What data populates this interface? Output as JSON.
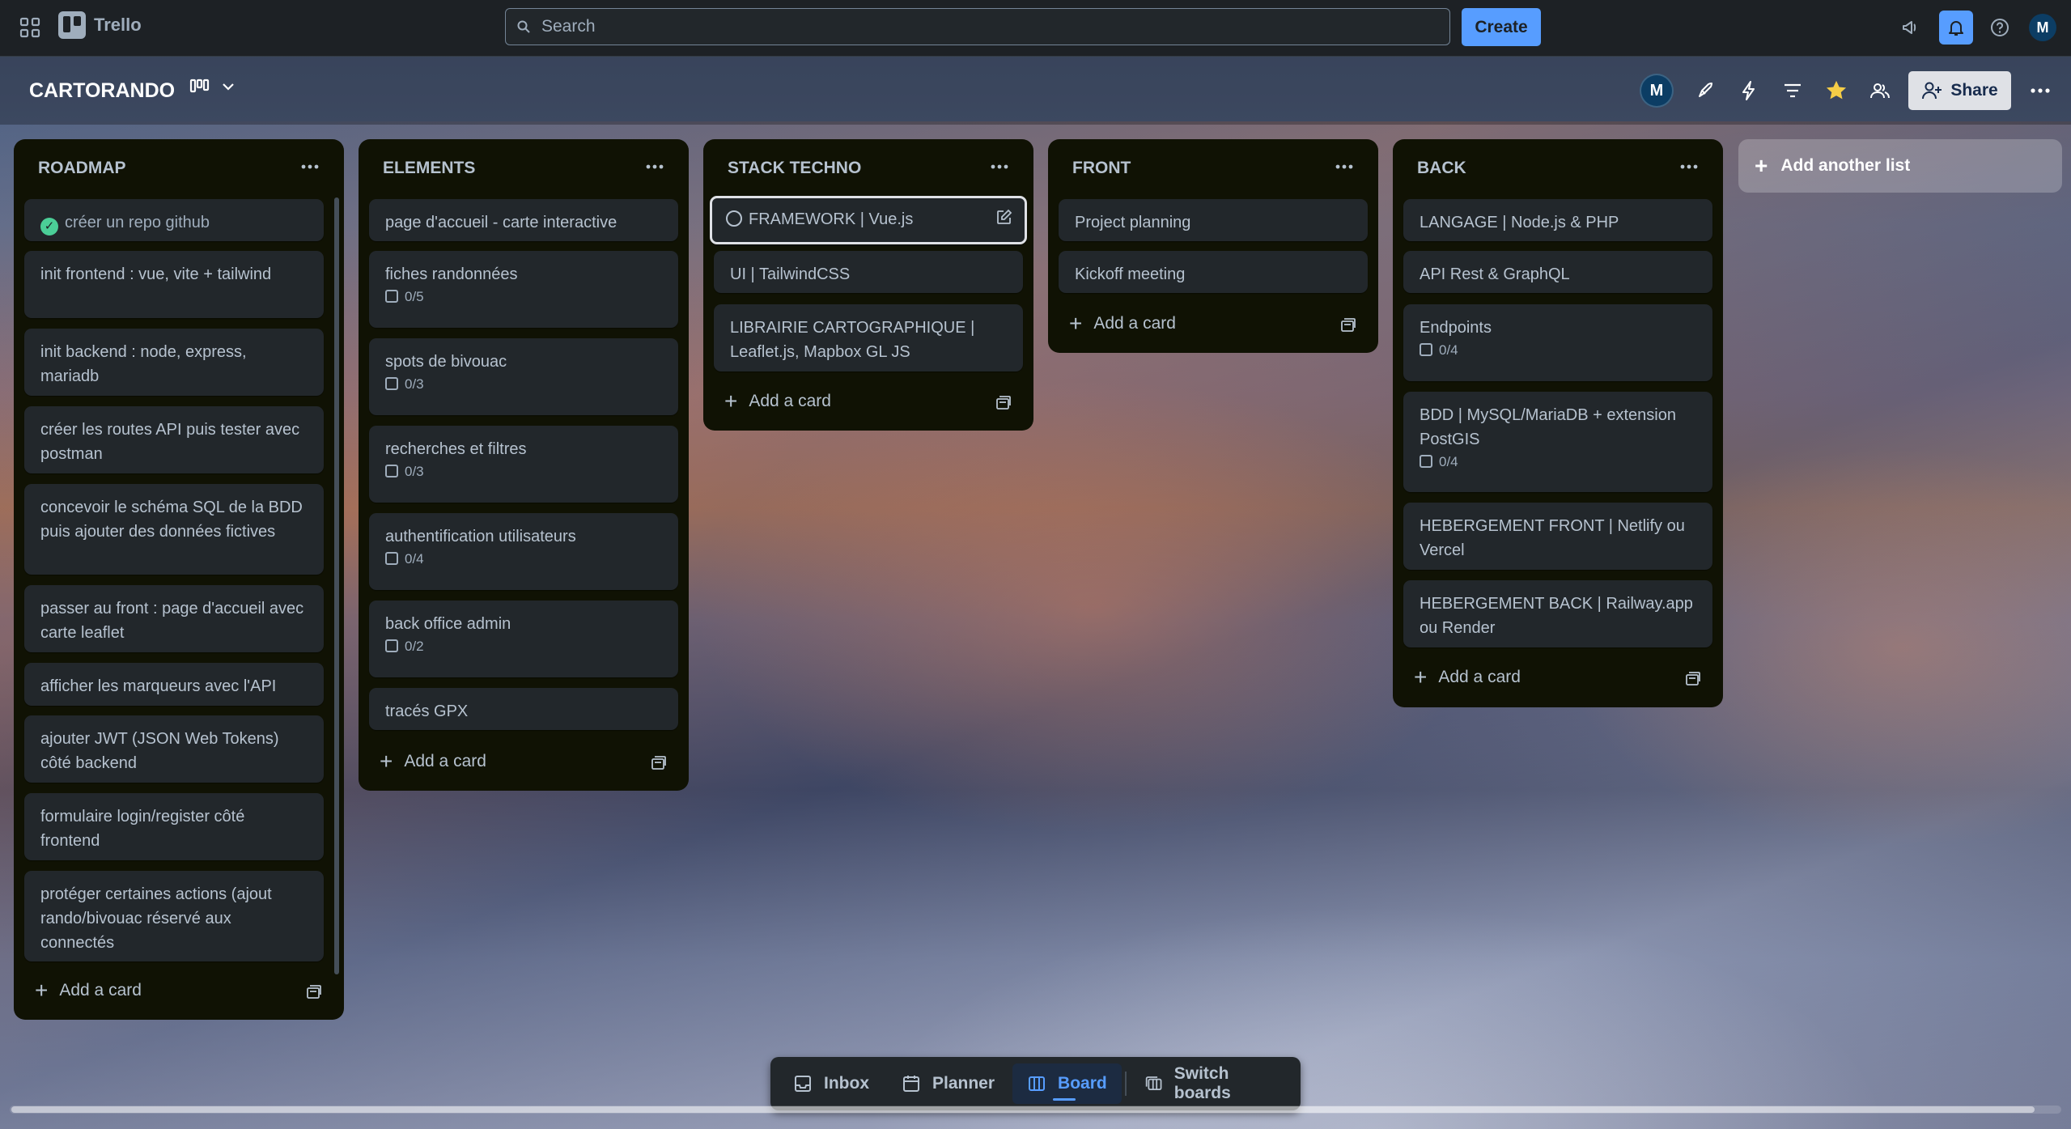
{
  "app": {
    "name": "Trello"
  },
  "search": {
    "placeholder": "Search"
  },
  "topbar": {
    "create_label": "Create",
    "avatar_initial": "M"
  },
  "board": {
    "title": "CARTORANDO",
    "member_initial": "M",
    "share_label": "Share"
  },
  "lists": [
    {
      "title": "ROADMAP",
      "cards": [
        {
          "text": "créer un repo github",
          "done": true
        },
        {
          "text": "init frontend : vue, vite + tailwind"
        },
        {
          "text": "init backend : node, express, mariadb"
        },
        {
          "text": "créer les routes API puis tester avec postman"
        },
        {
          "text": "concevoir le schéma SQL de la BDD puis ajouter des données fictives"
        },
        {
          "text": "passer au front : page d'accueil avec carte leaflet"
        },
        {
          "text": "afficher les marqueurs avec l'API"
        },
        {
          "text": "ajouter JWT (JSON Web Tokens) côté backend"
        },
        {
          "text": "formulaire login/register côté frontend"
        },
        {
          "text": "protéger certaines actions (ajout rando/bivouac réservé aux connectés"
        }
      ],
      "add_label": "Add a card"
    },
    {
      "title": "ELEMENTS",
      "cards": [
        {
          "text": "page d'accueil - carte interactive"
        },
        {
          "text": "fiches randonnées",
          "checklist": "0/5"
        },
        {
          "text": "spots de bivouac",
          "checklist": "0/3"
        },
        {
          "text": "recherches et filtres",
          "checklist": "0/3"
        },
        {
          "text": "authentification utilisateurs",
          "checklist": "0/4"
        },
        {
          "text": "back office admin",
          "checklist": "0/2"
        },
        {
          "text": "tracés GPX"
        }
      ],
      "add_label": "Add a card"
    },
    {
      "title": "STACK TECHNO",
      "cards": [
        {
          "text": "FRAMEWORK | Vue.js",
          "selected": true
        },
        {
          "text": "UI | TailwindCSS"
        },
        {
          "text": "LIBRAIRIE CARTOGRAPHIQUE | Leaflet.js, Mapbox GL JS"
        }
      ],
      "add_label": "Add a card"
    },
    {
      "title": "FRONT",
      "cards": [
        {
          "text": "Project planning"
        },
        {
          "text": "Kickoff meeting"
        }
      ],
      "add_label": "Add a card"
    },
    {
      "title": "BACK",
      "cards": [
        {
          "text": "LANGAGE | Node.js & PHP"
        },
        {
          "text": "API Rest & GraphQL"
        },
        {
          "text": "Endpoints",
          "checklist": "0/4"
        },
        {
          "text": "BDD | MySQL/MariaDB + extension PostGIS",
          "checklist": "0/4"
        },
        {
          "text": "HEBERGEMENT FRONT | Netlify ou Vercel"
        },
        {
          "text": "HEBERGEMENT BACK | Railway.app ou Render"
        }
      ],
      "add_label": "Add a card"
    }
  ],
  "add_list_label": "Add another list",
  "bottom_nav": {
    "inbox": "Inbox",
    "planner": "Planner",
    "board": "Board",
    "switch": "Switch boards"
  },
  "colors": {
    "accent": "#579dff",
    "list_bg": "#101204",
    "card_bg": "#22272b",
    "done_green": "#4bce97"
  }
}
